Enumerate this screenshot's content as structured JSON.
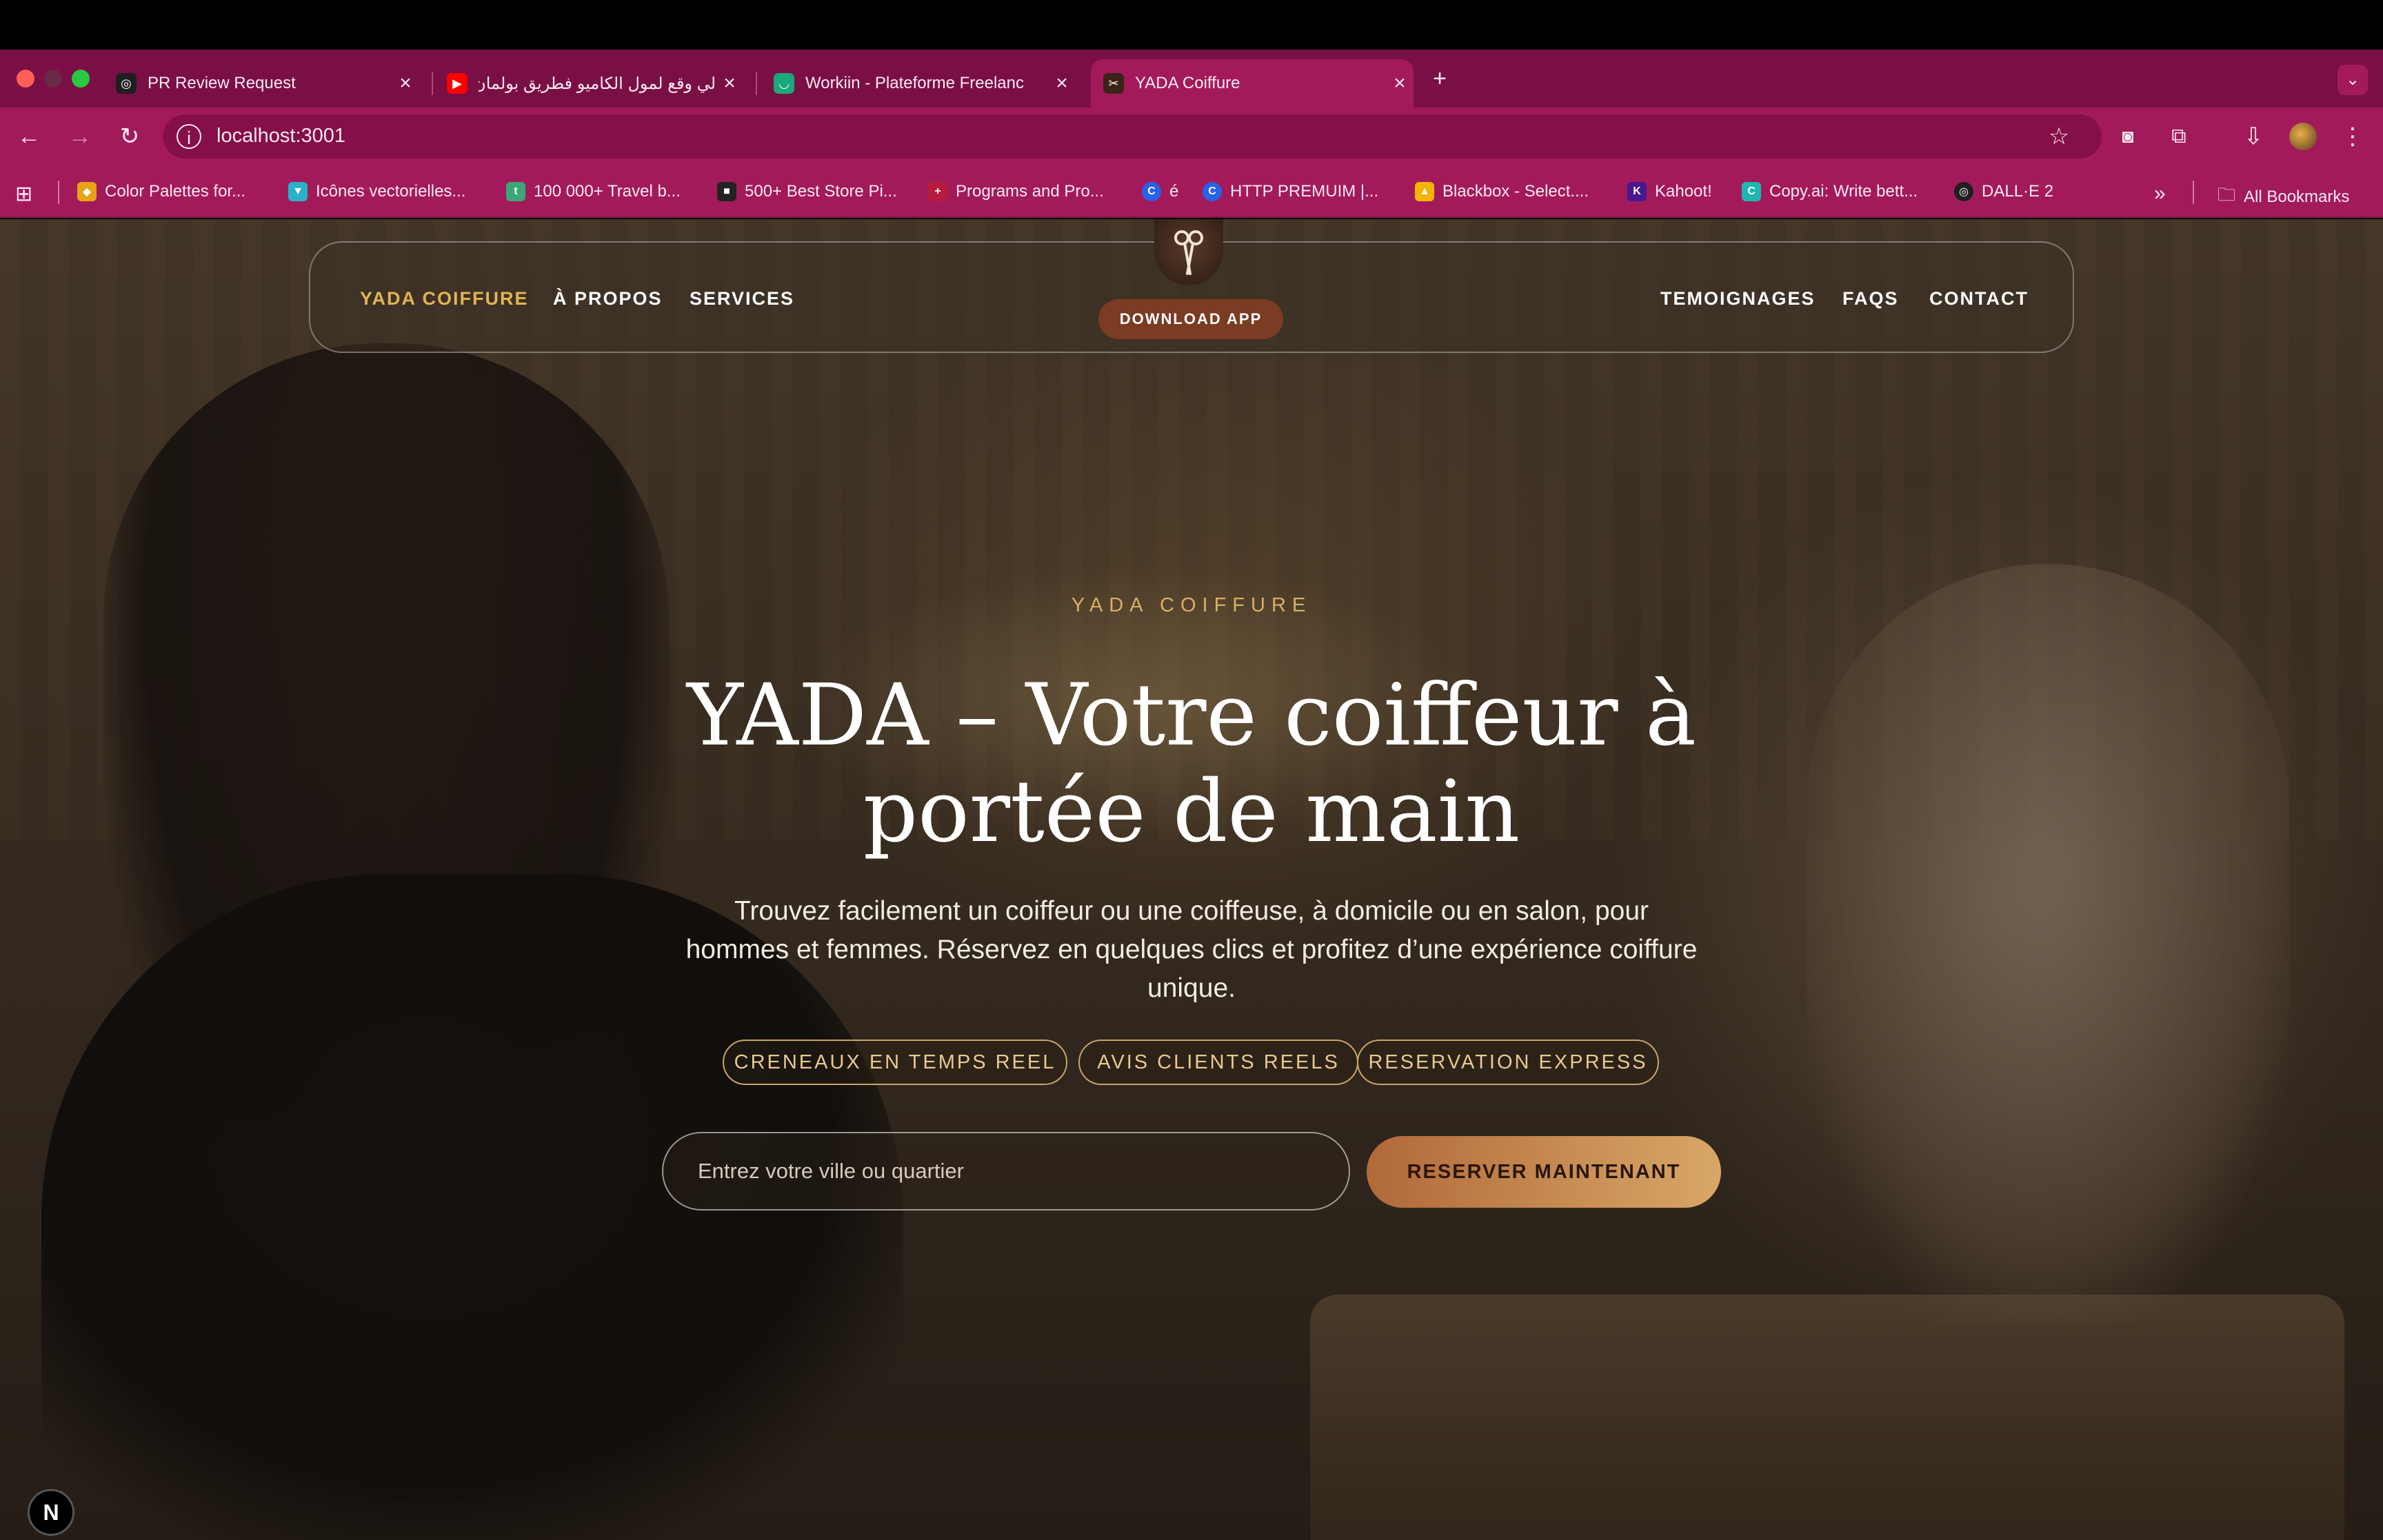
{
  "browser": {
    "tabs": [
      {
        "title": "PR Review Request",
        "icon": "openai-icon",
        "color": "#1f1f1f",
        "glyph": "◎"
      },
      {
        "title": "لي وقع لمول الكاميو فطريق بولمان",
        "icon": "youtube-icon",
        "color": "#ff0000",
        "glyph": "▶"
      },
      {
        "title": "Workiin - Plateforme Freelanc",
        "icon": "workiin-icon",
        "color": "#1aa87a",
        "glyph": "◡"
      },
      {
        "title": "YADA Coiffure",
        "icon": "scissors-icon",
        "color": "#3a2418",
        "glyph": "✂"
      }
    ],
    "new_tab_label": "+",
    "url": "localhost:3001",
    "bookmarks": [
      {
        "title": "Color Palettes for...",
        "icon": "coolors-icon",
        "color": "#e8a317",
        "glyph": "◆"
      },
      {
        "title": "Icônes vectorielles...",
        "icon": "flaticon-icon",
        "color": "#2ab0c9",
        "glyph": "▼"
      },
      {
        "title": "100 000+ Travel b...",
        "icon": "travel-icon",
        "color": "#3aa776",
        "glyph": "t"
      },
      {
        "title": "500+ Best Store Pi...",
        "icon": "store-icon",
        "color": "#222222",
        "glyph": "■"
      },
      {
        "title": "Programs and Pro...",
        "icon": "programs-icon",
        "color": "#b71c3c",
        "glyph": "+"
      },
      {
        "title": "é",
        "icon": "chrome-like-icon",
        "color": "#2862e9",
        "glyph": "C"
      },
      {
        "title": "HTTP PREMUIM |...",
        "icon": "http-icon",
        "color": "#2862e9",
        "glyph": "C"
      },
      {
        "title": "Blackbox - Select....",
        "icon": "blackbox-icon",
        "color": "#f4b400",
        "glyph": "▲"
      },
      {
        "title": "Kahoot!",
        "icon": "kahoot-icon",
        "color": "#46178f",
        "glyph": "K"
      },
      {
        "title": "Copy.ai: Write bett...",
        "icon": "copyai-icon",
        "color": "#1fb6b0",
        "glyph": "C"
      },
      {
        "title": "DALL·E 2",
        "icon": "openai-icon",
        "color": "#1f1f1f",
        "glyph": "◎"
      }
    ],
    "all_bookmarks": "All Bookmarks"
  },
  "nav": {
    "brand": "YADA COIFFURE",
    "about": "À PROPOS",
    "services": "SERVICES",
    "testimonials": "TEMOIGNAGES",
    "faqs": "FAQS",
    "contact": "CONTACT",
    "download": "DOWNLOAD APP"
  },
  "hero": {
    "eyebrow": "YADA COIFFURE",
    "headline": "YADA – Votre coiffeur à portée de main",
    "subtitle": "Trouvez facilement un coiffeur ou une coiffeuse, à domicile ou en salon, pour hommes et femmes. Réservez en quelques clics et profitez d’une expérience coiffure unique.",
    "features": [
      "CRENEAUX EN TEMPS REEL",
      "AVIS CLIENTS REELS",
      "RESERVATION EXPRESS"
    ],
    "search_placeholder": "Entrez votre ville ou quartier",
    "search_value": "",
    "cta": "RESERVER MAINTENANT"
  },
  "colors": {
    "accent_gold": "#e2b452",
    "tab_strip": "#7a0f45",
    "toolbar": "#a31a5b",
    "cta_start": "#b1693a",
    "cta_end": "#d8a766"
  },
  "dev_badge": "N"
}
